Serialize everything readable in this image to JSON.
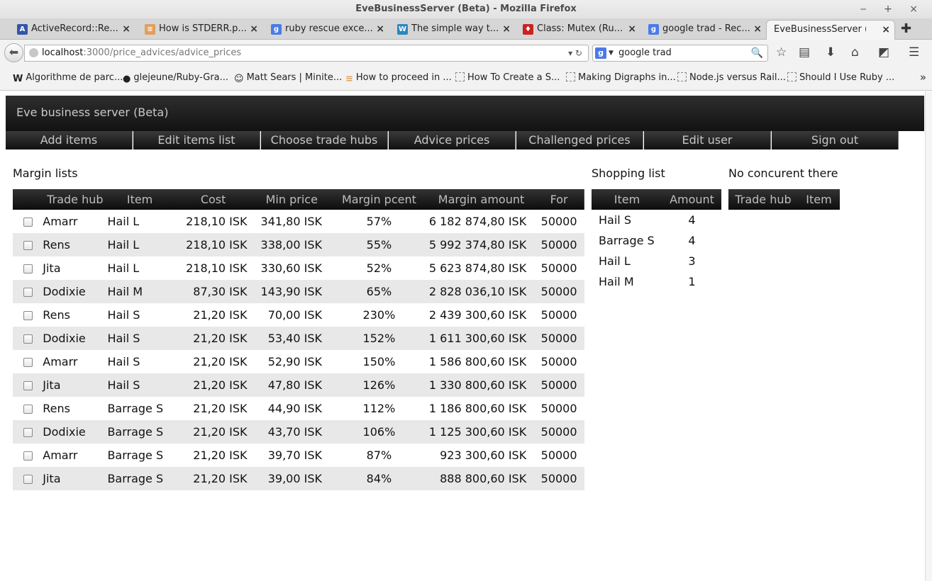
{
  "window": {
    "title": "EveBusinessServer (Beta) - Mozilla Firefox",
    "controls": "‒ + ×"
  },
  "tabs": [
    {
      "label": "ActiveRecord::Re...",
      "icon": "A",
      "color": "#3355aa"
    },
    {
      "label": "How is STDERR.p...",
      "icon": "≡",
      "color": "#e0a060"
    },
    {
      "label": "ruby rescue exce...",
      "icon": "g",
      "color": "#4a7be8"
    },
    {
      "label": "The simple way t...",
      "icon": "W",
      "color": "#2b87c0"
    },
    {
      "label": "Class: Mutex (Ru...",
      "icon": "♦",
      "color": "#cc2222"
    },
    {
      "label": "google trad - Rec...",
      "icon": "g",
      "color": "#4a7be8"
    },
    {
      "label": "EveBusinessServer (...",
      "icon": "",
      "color": "#f5f5f5"
    }
  ],
  "nav": {
    "url_host": "localhost",
    "url_path": ":3000/price_advices/advice_prices",
    "search_value": "google trad",
    "search_engine_letter": "g"
  },
  "bookmarks": [
    {
      "label": "Algorithme de parc...",
      "icon": "W"
    },
    {
      "label": "glejeune/Ruby-Gra...",
      "icon": "●"
    },
    {
      "label": "Matt Sears | Minite...",
      "icon": "☺"
    },
    {
      "label": "How to proceed in ...",
      "icon": "≡"
    },
    {
      "label": "How To Create a S...",
      "icon": ""
    },
    {
      "label": "Making Digraphs in...",
      "icon": ""
    },
    {
      "label": "Node.js versus Rail...",
      "icon": ""
    },
    {
      "label": "Should I Use Ruby ...",
      "icon": ""
    }
  ],
  "app": {
    "title": "Eve business server (Beta)",
    "menu": [
      "Add items",
      "Edit items list",
      "Choose trade hubs",
      "Advice prices",
      "Challenged prices",
      "Edit user",
      "Sign out"
    ]
  },
  "margin": {
    "title": "Margin lists",
    "headers": [
      "Trade hub",
      "Item",
      "Cost",
      "Min price",
      "Margin pcent",
      "Margin amount",
      "For"
    ],
    "rows": [
      [
        "Amarr",
        "Hail L",
        "218,10 ISK",
        "341,80 ISK",
        "57%",
        "6 182 874,80 ISK",
        "50000"
      ],
      [
        "Rens",
        "Hail L",
        "218,10 ISK",
        "338,00 ISK",
        "55%",
        "5 992 374,80 ISK",
        "50000"
      ],
      [
        "Jita",
        "Hail L",
        "218,10 ISK",
        "330,60 ISK",
        "52%",
        "5 623 874,80 ISK",
        "50000"
      ],
      [
        "Dodixie",
        "Hail M",
        "87,30 ISK",
        "143,90 ISK",
        "65%",
        "2 828 036,10 ISK",
        "50000"
      ],
      [
        "Rens",
        "Hail S",
        "21,20 ISK",
        "70,00 ISK",
        "230%",
        "2 439 300,60 ISK",
        "50000"
      ],
      [
        "Dodixie",
        "Hail S",
        "21,20 ISK",
        "53,40 ISK",
        "152%",
        "1 611 300,60 ISK",
        "50000"
      ],
      [
        "Amarr",
        "Hail S",
        "21,20 ISK",
        "52,90 ISK",
        "150%",
        "1 586 800,60 ISK",
        "50000"
      ],
      [
        "Jita",
        "Hail S",
        "21,20 ISK",
        "47,80 ISK",
        "126%",
        "1 330 800,60 ISK",
        "50000"
      ],
      [
        "Rens",
        "Barrage S",
        "21,20 ISK",
        "44,90 ISK",
        "112%",
        "1 186 800,60 ISK",
        "50000"
      ],
      [
        "Dodixie",
        "Barrage S",
        "21,20 ISK",
        "43,70 ISK",
        "106%",
        "1 125 300,60 ISK",
        "50000"
      ],
      [
        "Amarr",
        "Barrage S",
        "21,20 ISK",
        "39,70 ISK",
        "87%",
        "923 300,60 ISK",
        "50000"
      ],
      [
        "Jita",
        "Barrage S",
        "21,20 ISK",
        "39,00 ISK",
        "84%",
        "888 800,60 ISK",
        "50000"
      ]
    ]
  },
  "shopping": {
    "title": "Shopping list",
    "headers": [
      "Item",
      "Amount"
    ],
    "rows": [
      [
        "Hail S",
        "4"
      ],
      [
        "Barrage S",
        "4"
      ],
      [
        "Hail L",
        "3"
      ],
      [
        "Hail M",
        "1"
      ]
    ]
  },
  "concurrent": {
    "title": "No concurent there",
    "headers": [
      "Trade hub",
      "Item"
    ]
  }
}
